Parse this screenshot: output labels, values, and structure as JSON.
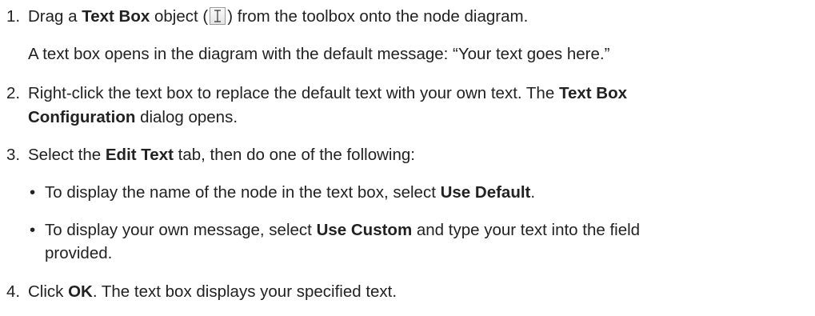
{
  "steps": [
    {
      "number": "1.",
      "before_bold": "Drag a ",
      "bold": "Text Box",
      "after_bold": " object (",
      "after_icon": ") from the toolbox onto the node diagram.",
      "icon": "text-box-tool-icon",
      "note": "A text box opens in the diagram with the default message: “Your text goes here.”"
    },
    {
      "number": "2.",
      "line1_before": "Right-click the text box to replace the default text with your own text. The ",
      "line1_bold": "Text Box",
      "line2_bold": "Configuration",
      "line2_after": " dialog opens."
    },
    {
      "number": "3.",
      "before_bold": "Select the ",
      "bold": "Edit Text",
      "after_bold": " tab, then do one of the following:",
      "bullets": [
        {
          "bullet": "•",
          "before_bold": "To display the name of the node in the text box, select ",
          "bold": "Use Default",
          "after_bold": "."
        },
        {
          "bullet": "•",
          "before_bold": "To display your own message, select ",
          "bold": "Use Custom",
          "after_bold": " and type your text into the field",
          "continuation": "provided."
        }
      ]
    },
    {
      "number": "4.",
      "before_bold": "Click ",
      "bold": "OK",
      "after_bold": ". The text box displays your specified text."
    }
  ]
}
